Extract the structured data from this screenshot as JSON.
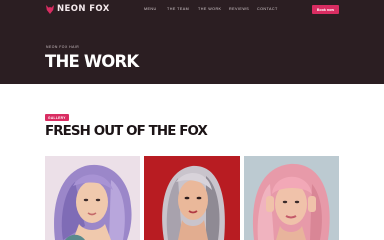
{
  "brand": {
    "name": "NEON FOX",
    "accent": "#d92d62",
    "dark": "#2b1e22"
  },
  "nav": {
    "items": [
      "MENU",
      "THE TEAM",
      "THE WORK",
      "REVIEWS",
      "CONTACT"
    ],
    "cta": "Book now"
  },
  "hero": {
    "breadcrumb": "NEON FOX HAIR",
    "title": "THE WORK"
  },
  "gallery": {
    "badge": "GALLERY",
    "title": "FRESH OUT OF THE FOX",
    "photos": [
      "lavender-hair-portrait",
      "silver-hair-portrait",
      "pink-bangs-portrait"
    ]
  }
}
